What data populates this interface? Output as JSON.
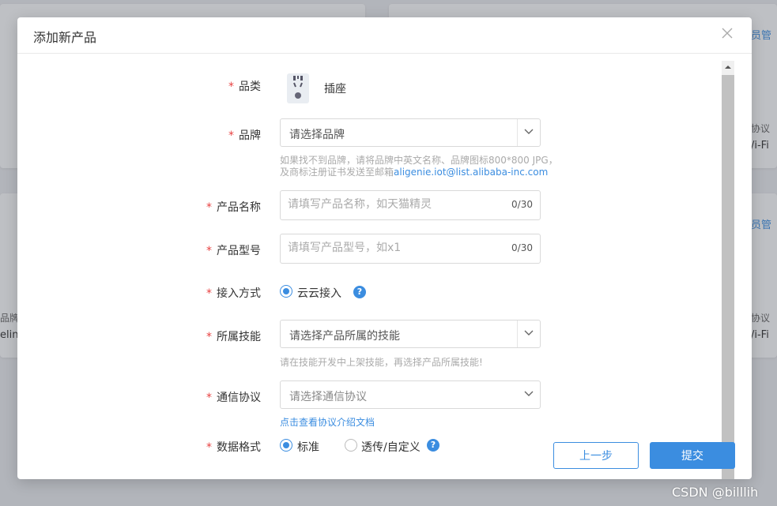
{
  "background": {
    "card_texts": {
      "top_right_link": "员管",
      "top_right_label": "协议",
      "top_right_value": "/i-Fi",
      "mid_right_link": "员管",
      "mid_right_label": "协议",
      "mid_right_value": "/i-Fi",
      "mid_left_label": "品牌",
      "mid_left_value": "elin"
    }
  },
  "modal": {
    "title": "添加新产品",
    "category": {
      "label": "品类",
      "value": "插座",
      "icon": "socket-icon"
    },
    "brand": {
      "label": "品牌",
      "placeholder": "请选择品牌",
      "hint_line1": "如果找不到品牌，请将品牌中英文名称、品牌图标800*800 JPG，",
      "hint_line2_prefix": "及商标注册证书发送至邮箱",
      "hint_email": "aligenie.iot@list.alibaba-inc.com"
    },
    "product_name": {
      "label": "产品名称",
      "placeholder": "请填写产品名称，如天猫精灵",
      "value": "",
      "counter": "0/30"
    },
    "product_model": {
      "label": "产品型号",
      "placeholder": "请填写产品型号，如x1",
      "value": "",
      "counter": "0/30"
    },
    "access_method": {
      "label": "接入方式",
      "option": "云云接入",
      "selected": true
    },
    "skill": {
      "label": "所属技能",
      "placeholder": "请选择产品所属的技能",
      "hint": "请在技能开发中上架技能，再选择产品所属技能!"
    },
    "protocol": {
      "label": "通信协议",
      "placeholder": "请选择通信协议",
      "link": "点击查看协议介绍文档"
    },
    "data_format": {
      "label": "数据格式",
      "options": [
        "标准",
        "透传/自定义"
      ],
      "selected": "标准"
    },
    "buttons": {
      "prev": "上一步",
      "submit": "提交"
    },
    "required_mark": "*"
  },
  "watermark": "CSDN @billlih",
  "colors": {
    "accent": "#3b8de0",
    "required": "#e84141"
  }
}
